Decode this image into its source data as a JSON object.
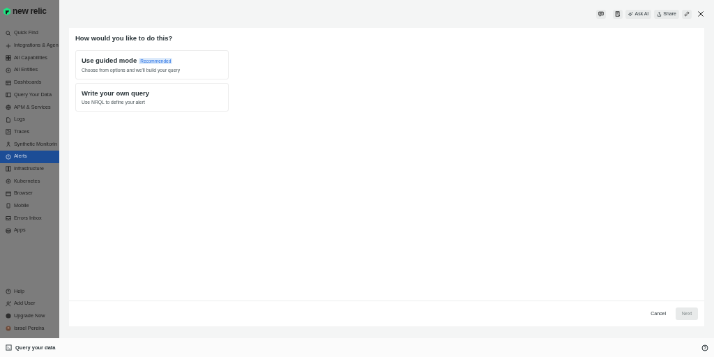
{
  "logo": {
    "text": "new relic"
  },
  "sidebar": {
    "items": [
      {
        "label": "Quick Find",
        "selected": false
      },
      {
        "label": "Integrations & Agen",
        "selected": false
      },
      {
        "label": "All Capabilities",
        "selected": false
      },
      {
        "label": "All Entities",
        "selected": false
      },
      {
        "label": "Dashboards",
        "selected": false
      },
      {
        "label": "Query Your Data",
        "selected": false
      },
      {
        "label": "APM & Services",
        "selected": false
      },
      {
        "label": "Logs",
        "selected": false
      },
      {
        "label": "Traces",
        "selected": false
      },
      {
        "label": "Synthetic Monitorin",
        "selected": false
      },
      {
        "label": "Alerts",
        "selected": true
      },
      {
        "label": "Infrastructure",
        "selected": false
      },
      {
        "label": "Kubernetes",
        "selected": false
      },
      {
        "label": "Browser",
        "selected": false
      },
      {
        "label": "Mobile",
        "selected": false
      },
      {
        "label": "Errors Inbox",
        "selected": false
      },
      {
        "label": "Apps",
        "selected": false
      }
    ],
    "footer_items": [
      {
        "label": "Help",
        "kind": "help"
      },
      {
        "label": "Add User",
        "kind": "user"
      },
      {
        "label": "Upgrade Now",
        "kind": "upgrade"
      },
      {
        "label": "Israel Pereira",
        "kind": "avatar"
      }
    ]
  },
  "toolbar": {
    "buttons": [
      {
        "label": "Ask AI",
        "kind": "ai"
      },
      {
        "label": "Share",
        "kind": "share"
      }
    ]
  },
  "dialog": {
    "question": "How would you like to do this?",
    "options": [
      {
        "title": "Use guided mode",
        "badge": "Recommended",
        "description": "Choose from options and we'll build your query"
      },
      {
        "title": "Write your own query",
        "description": "Use NRQL to define your alert"
      }
    ],
    "cancel": "Cancel",
    "next": {
      "label": "Next",
      "disabled": true
    }
  },
  "bottom_bar": {
    "label": "Query your data"
  }
}
